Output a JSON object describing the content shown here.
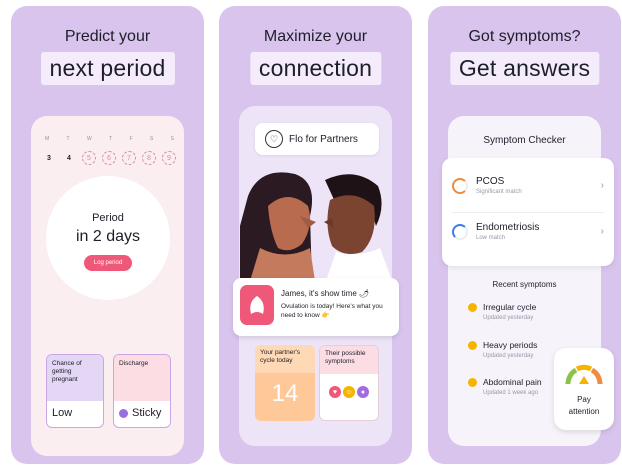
{
  "panel1": {
    "heading_line1": "Predict your",
    "heading_line2": "next period",
    "weekdays": [
      "M",
      "T",
      "W",
      "T",
      "F",
      "S",
      "S"
    ],
    "days": [
      "3",
      "4",
      "5",
      "6",
      "7",
      "8",
      "9"
    ],
    "status_line1": "Period",
    "status_line2": "in 2 days",
    "log_button": "Log period",
    "card1": {
      "label": "Chance of getting pregnant",
      "value": "Low"
    },
    "card2": {
      "label": "Discharge",
      "value": "Sticky"
    }
  },
  "panel2": {
    "heading_line1": "Maximize your",
    "heading_line2": "connection",
    "partners_label": "Flo for Partners",
    "notification": {
      "title": "James, it's show time 🌶",
      "body": "Ovulation is today! Here's what you need to know 👉"
    },
    "cycle_card": {
      "label": "Your partner's cycle today",
      "value": "14"
    },
    "symptoms_card": {
      "label": "Their possible symptoms"
    }
  },
  "panel3": {
    "heading_line1": "Got symptoms?",
    "heading_line2": "Get answers",
    "checker_title": "Symptom Checker",
    "matches": [
      {
        "name": "PCOS",
        "sub": "Significant match",
        "color": "#f08a3c"
      },
      {
        "name": "Endometriosis",
        "sub": "Low match",
        "color": "#3f7de0"
      }
    ],
    "recent_title": "Recent symptoms",
    "recent": [
      {
        "name": "Irregular cycle",
        "sub": "Updated yesterday"
      },
      {
        "name": "Heavy periods",
        "sub": "Updated yesterday"
      },
      {
        "name": "Abdominal pain",
        "sub": "Updated 1 week ago"
      }
    ],
    "pay_attention_line1": "Pay",
    "pay_attention_line2": "attention"
  },
  "colors": {
    "panel_bg": "#d9c4ee",
    "accent_pink": "#f0587a",
    "accent_orange": "#ffc899"
  }
}
